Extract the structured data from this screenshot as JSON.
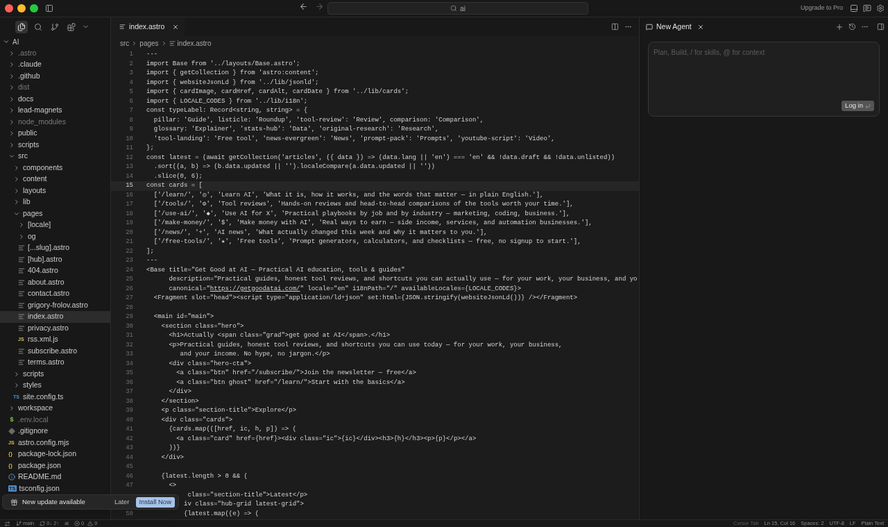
{
  "title_bar": {
    "search": "ai",
    "upgrade": "Upgrade to Pro"
  },
  "sidebar": {
    "tools": [
      {
        "kind": "files",
        "selected": true
      },
      {
        "kind": "search",
        "selected": false
      },
      {
        "kind": "git",
        "selected": false
      },
      {
        "kind": "extensions",
        "selected": false
      }
    ],
    "root": {
      "name": "AI",
      "expanded": true
    },
    "tree": [
      {
        "name": ".astro",
        "kind": "folder",
        "expanded": false,
        "selected": false,
        "dimmed": true
      },
      {
        "name": ".claude",
        "kind": "folder",
        "expanded": false,
        "selected": false,
        "dimmed": false
      },
      {
        "name": ".github",
        "kind": "folder",
        "expanded": false,
        "selected": false,
        "dimmed": false
      },
      {
        "name": "dist",
        "kind": "folder",
        "expanded": false,
        "selected": false,
        "dimmed": true
      },
      {
        "name": "docs",
        "kind": "folder",
        "expanded": false,
        "selected": false,
        "dimmed": false
      },
      {
        "name": "lead-magnets",
        "kind": "folder",
        "expanded": false,
        "selected": false,
        "dimmed": false
      },
      {
        "name": "node_modules",
        "kind": "folder",
        "expanded": false,
        "selected": false,
        "dimmed": true
      },
      {
        "name": "public",
        "kind": "folder",
        "expanded": false,
        "selected": false,
        "dimmed": false
      },
      {
        "name": "scripts",
        "kind": "folder",
        "expanded": false,
        "selected": false,
        "dimmed": false
      },
      {
        "name": "src",
        "kind": "folder",
        "expanded": true,
        "selected": false,
        "dimmed": false,
        "children": [
          {
            "name": "components",
            "kind": "folder",
            "expanded": false,
            "selected": false,
            "dimmed": false
          },
          {
            "name": "content",
            "kind": "folder",
            "expanded": false,
            "selected": false,
            "dimmed": false
          },
          {
            "name": "layouts",
            "kind": "folder",
            "expanded": false,
            "selected": false,
            "dimmed": false
          },
          {
            "name": "lib",
            "kind": "folder",
            "expanded": false,
            "selected": false,
            "dimmed": false
          },
          {
            "name": "pages",
            "kind": "folder",
            "expanded": true,
            "selected": false,
            "dimmed": false,
            "children": [
              {
                "name": "[locale]",
                "kind": "folder",
                "expanded": false,
                "selected": false,
                "dimmed": false
              },
              {
                "name": "og",
                "kind": "folder",
                "expanded": false,
                "selected": false,
                "dimmed": false
              },
              {
                "name": "[...slug].astro",
                "kind": "astro",
                "selected": false,
                "dimmed": false
              },
              {
                "name": "[hub].astro",
                "kind": "astro",
                "selected": false,
                "dimmed": false
              },
              {
                "name": "404.astro",
                "kind": "astro",
                "selected": false,
                "dimmed": false
              },
              {
                "name": "about.astro",
                "kind": "astro",
                "selected": false,
                "dimmed": false
              },
              {
                "name": "contact.astro",
                "kind": "astro",
                "selected": false,
                "dimmed": false
              },
              {
                "name": "grigory-frolov.astro",
                "kind": "astro",
                "selected": false,
                "dimmed": false
              },
              {
                "name": "index.astro",
                "kind": "astro",
                "selected": true,
                "dimmed": false
              },
              {
                "name": "privacy.astro",
                "kind": "astro",
                "selected": false,
                "dimmed": false
              },
              {
                "name": "rss.xml.js",
                "kind": "js",
                "badge": "JS",
                "selected": false,
                "dimmed": false
              },
              {
                "name": "subscribe.astro",
                "kind": "astro",
                "selected": false,
                "dimmed": false
              },
              {
                "name": "terms.astro",
                "kind": "astro",
                "selected": false,
                "dimmed": false
              }
            ]
          },
          {
            "name": "scripts",
            "kind": "folder",
            "expanded": false,
            "selected": false,
            "dimmed": false
          },
          {
            "name": "styles",
            "kind": "folder",
            "expanded": false,
            "selected": false,
            "dimmed": false
          },
          {
            "name": "site.config.ts",
            "kind": "ts",
            "badge": "TS",
            "selected": false,
            "dimmed": false
          }
        ]
      },
      {
        "name": "workspace",
        "kind": "folder",
        "expanded": false,
        "selected": false,
        "dimmed": false
      },
      {
        "name": ".env.local",
        "kind": "env",
        "badge": "$",
        "selected": false,
        "dimmed": true
      },
      {
        "name": ".gitignore",
        "kind": "git",
        "selected": false,
        "dimmed": false
      },
      {
        "name": "astro.config.mjs",
        "kind": "js",
        "badge": "JS",
        "selected": false,
        "dimmed": false
      },
      {
        "name": "package-lock.json",
        "kind": "json",
        "badge": "{}",
        "selected": false,
        "dimmed": false
      },
      {
        "name": "package.json",
        "kind": "json",
        "badge": "{}",
        "selected": false,
        "dimmed": false
      },
      {
        "name": "README.md",
        "kind": "info",
        "selected": false,
        "dimmed": false
      },
      {
        "name": "tsconfig.json",
        "kind": "tsconfig",
        "badge": "TS",
        "selected": false,
        "dimmed": false
      }
    ]
  },
  "editor": {
    "tab": {
      "label": "index.astro",
      "selected": true
    },
    "breadcrumb": [
      "src",
      "pages",
      "index.astro"
    ],
    "lines": [
      {
        "n": "1",
        "text": "---",
        "current": false
      },
      {
        "n": "2",
        "text": "import Base from '../layouts/Base.astro';",
        "current": false
      },
      {
        "n": "3",
        "text": "import { getCollection } from 'astro:content';",
        "current": false
      },
      {
        "n": "4",
        "text": "import { websiteJsonLd } from '../lib/jsonld';",
        "current": false
      },
      {
        "n": "5",
        "text": "import { cardImage, cardHref, cardAlt, cardDate } from '../lib/cards';",
        "current": false
      },
      {
        "n": "6",
        "text": "import { LOCALE_CODES } from '../lib/i18n';",
        "current": false
      },
      {
        "n": "7",
        "text": "const typeLabel: Record<string, string> = {",
        "current": false
      },
      {
        "n": "8",
        "text": "  pillar: 'Guide', listicle: 'Roundup', 'tool-review': 'Review', comparison: 'Comparison',",
        "current": false
      },
      {
        "n": "9",
        "text": "  glossary: 'Explainer', 'stats-hub': 'Data', 'original-research': 'Research',",
        "current": false
      },
      {
        "n": "10",
        "text": "  'tool-landing': 'Free tool', 'news-evergreen': 'News', 'prompt-pack': 'Prompts', 'youtube-script': 'Video',",
        "current": false
      },
      {
        "n": "11",
        "text": "};",
        "current": false
      },
      {
        "n": "12",
        "text": "const latest = (await getCollection('articles', ({ data }) => (data.lang || 'en') === 'en' && !data.draft && !data.unlisted))",
        "current": false
      },
      {
        "n": "13",
        "text": "  .sort((a, b) => (b.data.updated || '').localeCompare(a.data.updated || ''))",
        "current": false
      },
      {
        "n": "14",
        "text": "  .slice(0, 6);",
        "current": false
      },
      {
        "n": "15",
        "text": "const cards = [",
        "current": true
      },
      {
        "n": "16",
        "text": "  ['/learn/', '◎', 'Learn AI', 'What it is, how it works, and the words that matter — in plain English.'],",
        "current": false
      },
      {
        "n": "17",
        "text": "  ['/tools/', '⚙', 'Tool reviews', 'Hands-on reviews and head-to-head comparisons of the tools worth your time.'],",
        "current": false
      },
      {
        "n": "18",
        "text": "  ['/use-ai/', '◆', 'Use AI for X', 'Practical playbooks by job and by industry — marketing, coding, business.'],",
        "current": false
      },
      {
        "n": "19",
        "text": "  ['/make-money/', '$', 'Make money with AI', 'Real ways to earn — side income, services, and automation businesses.'],",
        "current": false
      },
      {
        "n": "20",
        "text": "  ['/news/', '+', 'AI news', 'What actually changed this week and why it matters to you.'],",
        "current": false
      },
      {
        "n": "21",
        "text": "  ['/free-tools/', '★', 'Free tools', 'Prompt generators, calculators, and checklists — free, no signup to start.'],",
        "current": false
      },
      {
        "n": "22",
        "text": "];",
        "current": false
      },
      {
        "n": "23",
        "text": "---",
        "current": false
      },
      {
        "n": "24",
        "text": "<Base title=\"Get Good at AI — Practical AI education, tools & guides\"",
        "current": false
      },
      {
        "n": "25",
        "text": "      description=\"Practical guides, honest tool reviews, and shortcuts you can actually use — for your work, your business, and yo",
        "current": false
      },
      {
        "n": "26",
        "text": "      canonical=\"",
        "link": "https://getgoodatai.com/",
        "after": "\" locale=\"en\" i18nPath=\"/\" availableLocales={LOCALE_CODES}>",
        "current": false
      },
      {
        "n": "27",
        "text": "  <Fragment slot=\"head\"><script type=\"application/ld+json\" set:html={JSON.stringify(websiteJsonLd())} /></Fragment>",
        "current": false
      },
      {
        "n": "28",
        "current": false
      },
      {
        "n": "29",
        "text": "  <main id=\"main\">",
        "current": false
      },
      {
        "n": "30",
        "text": "    <section class=\"hero\">",
        "current": false
      },
      {
        "n": "31",
        "text": "      <h1>Actually <span class=\"grad\">get good at AI</span>.</h1>",
        "current": false
      },
      {
        "n": "32",
        "text": "      <p>Practical guides, honest tool reviews, and shortcuts you can use today — for your work, your business,",
        "current": false
      },
      {
        "n": "33",
        "text": "         and your income. No hype, no jargon.</p>",
        "current": false
      },
      {
        "n": "34",
        "text": "      <div class=\"hero-cta\">",
        "current": false
      },
      {
        "n": "35",
        "text": "        <a class=\"btn\" href=\"/subscribe/\">Join the newsletter — free</a>",
        "current": false
      },
      {
        "n": "36",
        "text": "        <a class=\"btn ghost\" href=\"/learn/\">Start with the basics</a>",
        "current": false
      },
      {
        "n": "37",
        "text": "      </div>",
        "current": false
      },
      {
        "n": "38",
        "text": "    </section>",
        "current": false
      },
      {
        "n": "39",
        "text": "    <p class=\"section-title\">Explore</p>",
        "current": false
      },
      {
        "n": "40",
        "text": "    <div class=\"cards\">",
        "current": false
      },
      {
        "n": "41",
        "text": "      {cards.map(([href, ic, h, p]) => (",
        "current": false
      },
      {
        "n": "42",
        "text": "        <a class=\"card\" href={href}><div class=\"ic\">{ic}</div><h3>{h}</h3><p>{p}</p></a>",
        "current": false
      },
      {
        "n": "43",
        "text": "      ))}",
        "current": false
      },
      {
        "n": "44",
        "text": "    </div>",
        "current": false
      },
      {
        "n": "45",
        "current": false
      },
      {
        "n": "46",
        "text": "    {latest.length > 0 && (",
        "current": false
      },
      {
        "n": "47",
        "text": "      <>",
        "current": false
      },
      {
        "text": "           class=\"section-title\">Latest</p>"
      },
      {
        "text": "          iv class=\"hub-grid latest-grid\">"
      },
      {
        "n": "50",
        "text": "          {latest.map((e) => (",
        "current": false
      }
    ]
  },
  "agent": {
    "tab": "New Agent",
    "placeholder": "Plan, Build, / for skills, @ for context",
    "login": "Log in"
  },
  "notification": {
    "message": "New update available",
    "later": "Later",
    "install": "Install Now"
  },
  "status_bar": {
    "branch": "main",
    "sync": "0↓ 2↑",
    "workspace": "ai",
    "errors": "0",
    "warnings": "0",
    "items": [
      "Cursor Tab",
      "Ln 15, Col 16",
      "Spaces: 2",
      "UTF-8",
      "LF",
      "Plain Text"
    ]
  }
}
